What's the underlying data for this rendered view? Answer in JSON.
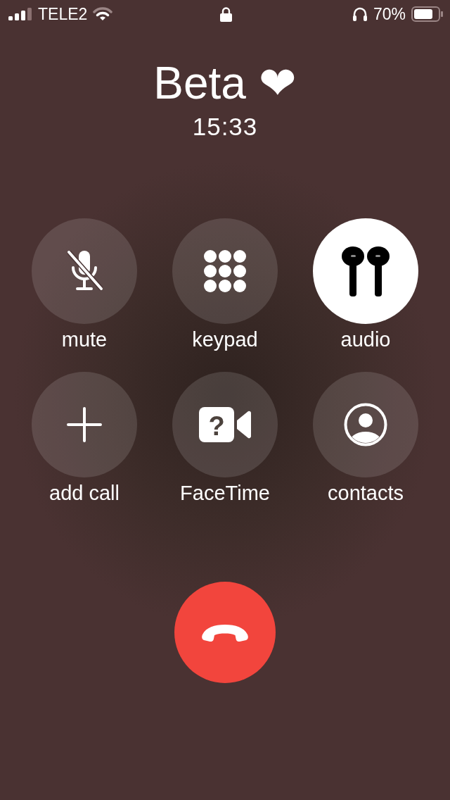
{
  "status_bar": {
    "carrier": "TELE2",
    "battery_percent": "70%"
  },
  "call": {
    "name": "Beta ❤",
    "duration": "15:33"
  },
  "controls": [
    {
      "kind": "mute",
      "label": "mute",
      "selected": false
    },
    {
      "kind": "keypad",
      "label": "keypad",
      "selected": false
    },
    {
      "kind": "audio",
      "label": "audio",
      "selected": true
    },
    {
      "kind": "add",
      "label": "add call",
      "selected": false
    },
    {
      "kind": "facetime",
      "label": "FaceTime",
      "selected": false,
      "icon_text": "?"
    },
    {
      "kind": "contacts",
      "label": "contacts",
      "selected": false
    }
  ]
}
